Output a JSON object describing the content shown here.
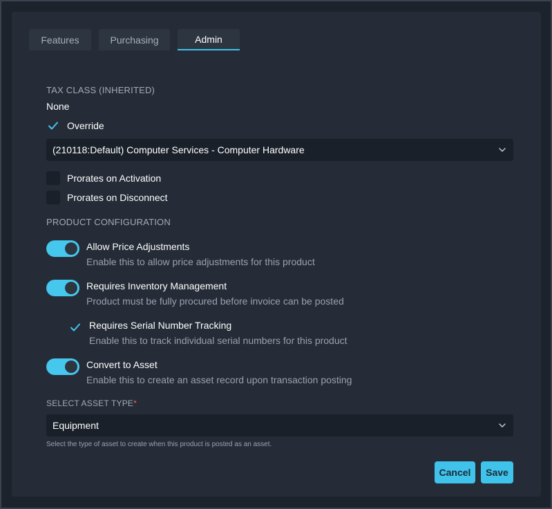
{
  "tabs": [
    {
      "label": "Features",
      "active": false
    },
    {
      "label": "Purchasing",
      "active": false
    },
    {
      "label": "Admin",
      "active": true
    }
  ],
  "tax_class": {
    "heading": "TAX CLASS (INHERITED)",
    "value": "None",
    "override_label": "Override",
    "override_checked": true,
    "selected_option": "(210118:Default) Computer Services - Computer Hardware"
  },
  "billing_options": [
    {
      "label": "Prorates on Activation",
      "checked": false
    },
    {
      "label": "Prorates on Disconnect",
      "checked": false
    }
  ],
  "product_configuration": {
    "heading": "PRODUCT CONFIGURATION",
    "allow_price": {
      "title": "Allow Price Adjustments",
      "description": "Enable this to allow price adjustments for this product",
      "on": true
    },
    "inventory": {
      "title": "Requires Inventory Management",
      "description": "Product must be fully procured before invoice can be posted",
      "on": true
    },
    "serial": {
      "title": "Requires Serial Number Tracking",
      "description": "Enable this to track individual serial numbers for this product",
      "checked": true
    },
    "asset": {
      "title": "Convert to Asset",
      "description": "Enable this to create an asset record upon transaction posting",
      "on": true
    }
  },
  "asset_type": {
    "label": "SELECT ASSET TYPE",
    "required_mark": "*",
    "selected_option": "Equipment",
    "hint": "Select the type of asset to create when this product is posted as an asset."
  },
  "actions": {
    "cancel_label": "Cancel",
    "save_label": "Save"
  },
  "colors": {
    "accent": "#3fc3ea",
    "background": "#1d232c",
    "panel": "#252c37",
    "required": "#ff5a6a"
  }
}
